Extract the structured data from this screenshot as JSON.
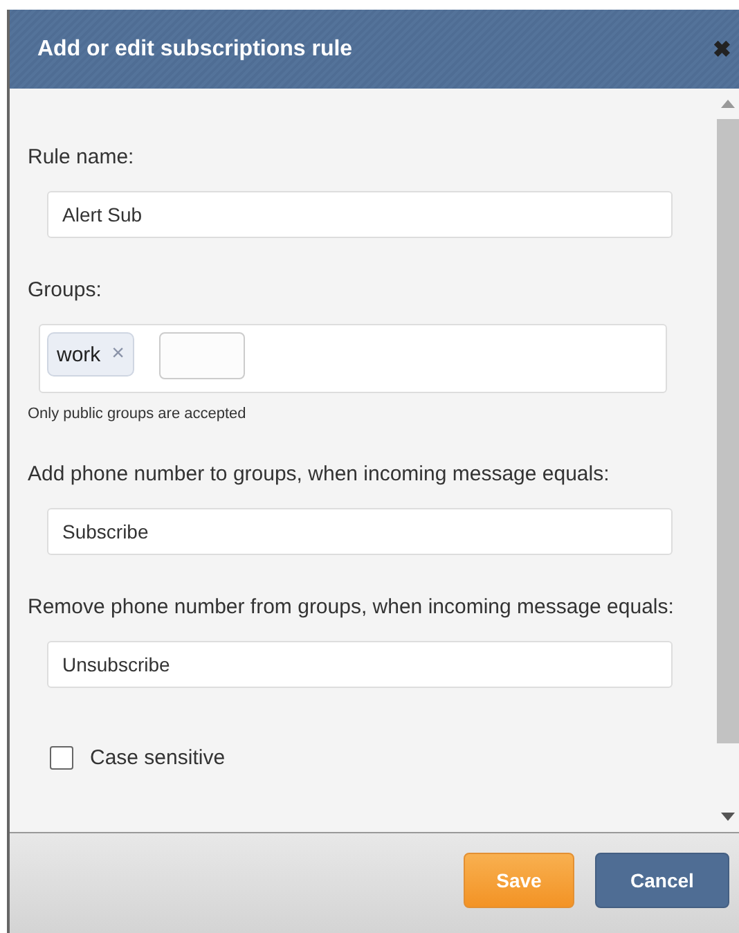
{
  "dialog": {
    "title": "Add or edit subscriptions rule",
    "close": "✖"
  },
  "fields": [
    {
      "kind": "text",
      "label": "Rule name:",
      "value": "Alert Sub"
    },
    {
      "kind": "tags",
      "label": "Groups:",
      "tags": [
        "work"
      ],
      "remove": "×",
      "hint": "Only public groups are accepted"
    },
    {
      "kind": "text",
      "label": "Add phone number to groups, when incoming message equals:",
      "value": "Subscribe"
    },
    {
      "kind": "text",
      "label": "Remove phone number from groups, when incoming message equals:",
      "value": "Unsubscribe"
    }
  ],
  "case_sensitive": {
    "label": "Case sensitive",
    "checked": false
  },
  "buttons": [
    {
      "kind": "primary",
      "label": "Save"
    },
    {
      "kind": "secondary",
      "label": "Cancel"
    }
  ]
}
